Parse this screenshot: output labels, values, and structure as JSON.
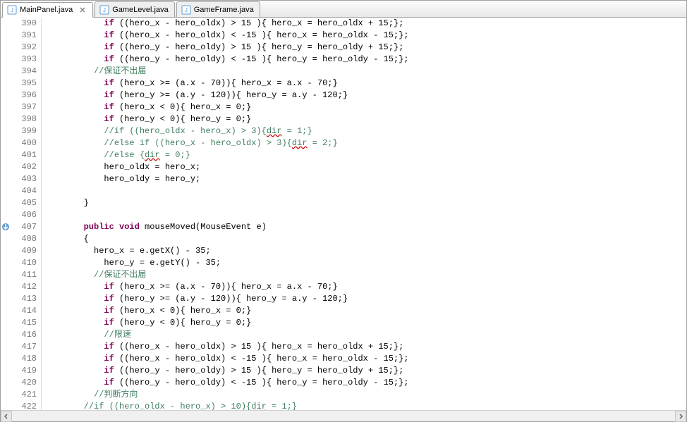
{
  "tabs": [
    {
      "label": "MainPanel.java",
      "active": true,
      "closeable": true
    },
    {
      "label": "GameLevel.java",
      "active": false,
      "closeable": false
    },
    {
      "label": "GameFrame.java",
      "active": false,
      "closeable": false
    }
  ],
  "gutter_start": 390,
  "gutter_end": 422,
  "marker_line": 407,
  "lines": [
    {
      "indent": 12,
      "tokens": [
        {
          "t": "k",
          "v": "if"
        },
        {
          "t": "n",
          "v": " ((hero_x - hero_oldx) > 15 ){ hero_x = hero_oldx + 15;};"
        }
      ]
    },
    {
      "indent": 12,
      "tokens": [
        {
          "t": "k",
          "v": "if"
        },
        {
          "t": "n",
          "v": " ((hero_x - hero_oldx) < -15 ){ hero_x = hero_oldx - 15;};"
        }
      ]
    },
    {
      "indent": 12,
      "tokens": [
        {
          "t": "k",
          "v": "if"
        },
        {
          "t": "n",
          "v": " ((hero_y - hero_oldy) > 15 ){ hero_y = hero_oldy + 15;};"
        }
      ]
    },
    {
      "indent": 12,
      "tokens": [
        {
          "t": "k",
          "v": "if"
        },
        {
          "t": "n",
          "v": " ((hero_y - hero_oldy) < -15 ){ hero_y = hero_oldy - 15;};"
        }
      ]
    },
    {
      "indent": 10,
      "tokens": [
        {
          "t": "c",
          "v": "//保证不出届"
        }
      ]
    },
    {
      "indent": 12,
      "tokens": [
        {
          "t": "k",
          "v": "if"
        },
        {
          "t": "n",
          "v": " (hero_x >= (a.x - 70)){ hero_x = a.x - 70;}"
        }
      ]
    },
    {
      "indent": 12,
      "tokens": [
        {
          "t": "k",
          "v": "if"
        },
        {
          "t": "n",
          "v": " (hero_y >= (a.y - 120)){ hero_y = a.y - 120;}"
        }
      ]
    },
    {
      "indent": 12,
      "tokens": [
        {
          "t": "k",
          "v": "if"
        },
        {
          "t": "n",
          "v": " (hero_x < 0){ hero_x = 0;}"
        }
      ]
    },
    {
      "indent": 12,
      "tokens": [
        {
          "t": "k",
          "v": "if"
        },
        {
          "t": "n",
          "v": " (hero_y < 0){ hero_y = 0;}"
        }
      ]
    },
    {
      "indent": 12,
      "tokens": [
        {
          "t": "c",
          "v": "//if ((hero_oldx - hero_x) > 3){"
        },
        {
          "t": "c",
          "v": "dir",
          "cls": "wavy"
        },
        {
          "t": "c",
          "v": " = 1;}"
        }
      ]
    },
    {
      "indent": 12,
      "tokens": [
        {
          "t": "c",
          "v": "//else if ((hero_x - hero_oldx) > 3){"
        },
        {
          "t": "c",
          "v": "dir",
          "cls": "wavy"
        },
        {
          "t": "c",
          "v": " = 2;}"
        }
      ]
    },
    {
      "indent": 12,
      "tokens": [
        {
          "t": "c",
          "v": "//else {"
        },
        {
          "t": "c",
          "v": "dir",
          "cls": "wavy"
        },
        {
          "t": "c",
          "v": " = 0;}"
        }
      ]
    },
    {
      "indent": 12,
      "tokens": [
        {
          "t": "n",
          "v": "hero_oldx = hero_x;"
        }
      ]
    },
    {
      "indent": 12,
      "tokens": [
        {
          "t": "n",
          "v": "hero_oldy = hero_y;"
        }
      ]
    },
    {
      "indent": 0,
      "tokens": []
    },
    {
      "indent": 8,
      "tokens": [
        {
          "t": "n",
          "v": "}"
        }
      ]
    },
    {
      "indent": 0,
      "tokens": []
    },
    {
      "indent": 8,
      "tokens": [
        {
          "t": "k",
          "v": "public"
        },
        {
          "t": "n",
          "v": " "
        },
        {
          "t": "k",
          "v": "void"
        },
        {
          "t": "n",
          "v": " mouseMoved(MouseEvent e)"
        }
      ]
    },
    {
      "indent": 8,
      "tokens": [
        {
          "t": "n",
          "v": "{"
        }
      ]
    },
    {
      "indent": 10,
      "tokens": [
        {
          "t": "n",
          "v": "hero_x = e.getX() - 35;"
        }
      ]
    },
    {
      "indent": 12,
      "tokens": [
        {
          "t": "n",
          "v": "hero_y = e.getY() - 35;"
        }
      ]
    },
    {
      "indent": 10,
      "tokens": [
        {
          "t": "c",
          "v": "//保证不出届"
        }
      ]
    },
    {
      "indent": 12,
      "tokens": [
        {
          "t": "k",
          "v": "if"
        },
        {
          "t": "n",
          "v": " (hero_x >= (a.x - 70)){ hero_x = a.x - 70;}"
        }
      ]
    },
    {
      "indent": 12,
      "tokens": [
        {
          "t": "k",
          "v": "if"
        },
        {
          "t": "n",
          "v": " (hero_y >= (a.y - 120)){ hero_y = a.y - 120;}"
        }
      ]
    },
    {
      "indent": 12,
      "tokens": [
        {
          "t": "k",
          "v": "if"
        },
        {
          "t": "n",
          "v": " (hero_x < 0){ hero_x = 0;}"
        }
      ]
    },
    {
      "indent": 12,
      "tokens": [
        {
          "t": "k",
          "v": "if"
        },
        {
          "t": "n",
          "v": " (hero_y < 0){ hero_y = 0;}"
        }
      ]
    },
    {
      "indent": 12,
      "tokens": [
        {
          "t": "c",
          "v": "//限速"
        }
      ]
    },
    {
      "indent": 12,
      "tokens": [
        {
          "t": "k",
          "v": "if"
        },
        {
          "t": "n",
          "v": " ((hero_x - hero_oldx) > 15 ){ hero_x = hero_oldx + 15;};"
        }
      ]
    },
    {
      "indent": 12,
      "tokens": [
        {
          "t": "k",
          "v": "if"
        },
        {
          "t": "n",
          "v": " ((hero_x - hero_oldx) < -15 ){ hero_x = hero_oldx - 15;};"
        }
      ]
    },
    {
      "indent": 12,
      "tokens": [
        {
          "t": "k",
          "v": "if"
        },
        {
          "t": "n",
          "v": " ((hero_y - hero_oldy) > 15 ){ hero_y = hero_oldy + 15;};"
        }
      ]
    },
    {
      "indent": 12,
      "tokens": [
        {
          "t": "k",
          "v": "if"
        },
        {
          "t": "n",
          "v": " ((hero_y - hero_oldy) < -15 ){ hero_y = hero_oldy - 15;};"
        }
      ]
    },
    {
      "indent": 10,
      "tokens": [
        {
          "t": "c",
          "v": "//判断方向"
        }
      ]
    },
    {
      "indent": 8,
      "tokens": [
        {
          "t": "c",
          "v": "//if ((hero_oldx - hero_x) > 10){"
        },
        {
          "t": "c",
          "v": "dir",
          "cls": "wavy"
        },
        {
          "t": "c",
          "v": " = 1;}"
        }
      ]
    }
  ]
}
